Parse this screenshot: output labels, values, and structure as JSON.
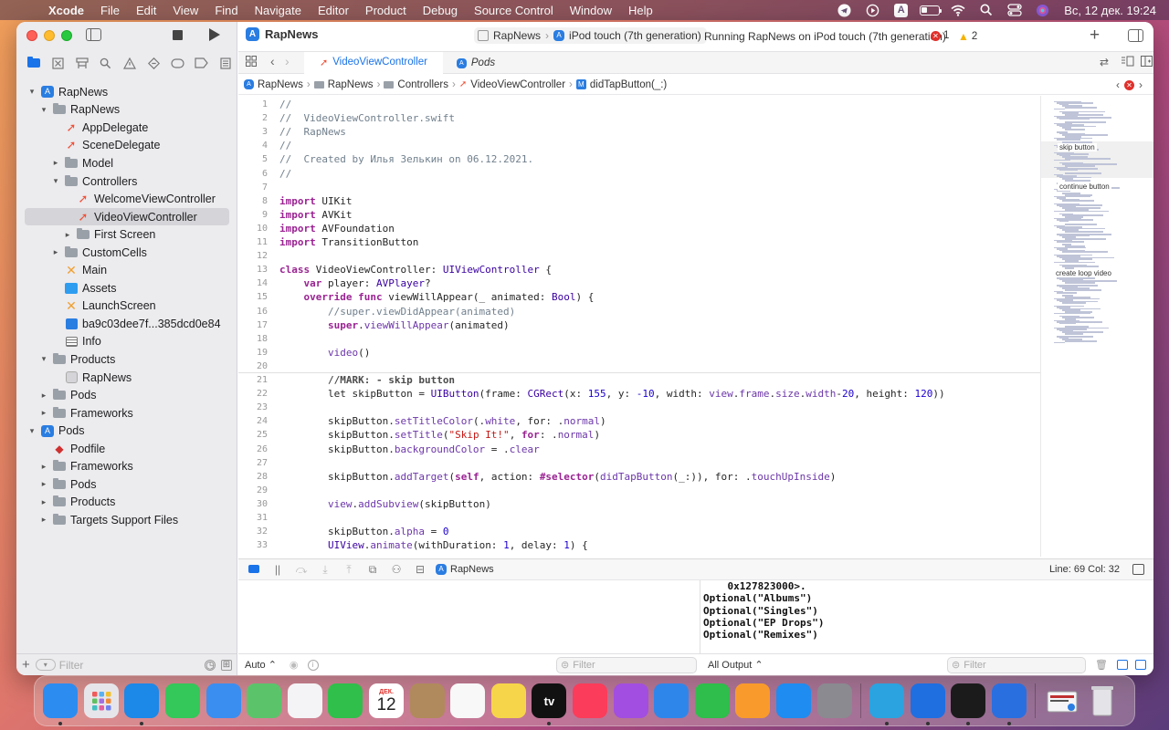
{
  "menubar": {
    "app_name": "Xcode",
    "items": [
      "File",
      "Edit",
      "View",
      "Find",
      "Navigate",
      "Editor",
      "Product",
      "Debug",
      "Source Control",
      "Window",
      "Help"
    ],
    "status_icons": [
      "telegram-icon",
      "play-circle-icon",
      "keyboard-A-icon",
      "battery-icon",
      "wifi-icon",
      "search-icon",
      "control-center-icon",
      "siri-icon"
    ],
    "keyboard_letter": "A",
    "clock": "Вс, 12 дек.  19:24"
  },
  "toolbar": {
    "project_title": "RapNews",
    "scheme": "RapNews",
    "device": "iPod touch (7th generation)",
    "status": "Running RapNews on iPod touch (7th generation)",
    "error_count": "1",
    "warning_count": "2"
  },
  "tabs": [
    {
      "label": "VideoViewController",
      "active": true
    },
    {
      "label": "Pods",
      "active": false
    }
  ],
  "breadcrumb": [
    "RapNews",
    "RapNews",
    "Controllers",
    "VideoViewController",
    "didTapButton(_:)"
  ],
  "breadcrumb_method_badge": "M",
  "navigator": {
    "filter_placeholder": "Filter",
    "tree": [
      {
        "label": "RapNews",
        "icon": "project",
        "depth": 0,
        "disclosure": "open"
      },
      {
        "label": "RapNews",
        "icon": "folder",
        "depth": 1,
        "disclosure": "open"
      },
      {
        "label": "AppDelegate",
        "icon": "swift",
        "depth": 2,
        "disclosure": ""
      },
      {
        "label": "SceneDelegate",
        "icon": "swift",
        "depth": 2,
        "disclosure": ""
      },
      {
        "label": "Model",
        "icon": "folder",
        "depth": 2,
        "disclosure": "closed"
      },
      {
        "label": "Controllers",
        "icon": "folder",
        "depth": 2,
        "disclosure": "open"
      },
      {
        "label": "WelcomeViewController",
        "icon": "swift",
        "depth": 3,
        "disclosure": ""
      },
      {
        "label": "VideoViewController",
        "icon": "swift",
        "depth": 3,
        "disclosure": "",
        "selected": true
      },
      {
        "label": "First Screen",
        "icon": "folder",
        "depth": 3,
        "disclosure": "closed"
      },
      {
        "label": "CustomCells",
        "icon": "folder",
        "depth": 2,
        "disclosure": "closed"
      },
      {
        "label": "Main",
        "icon": "xib",
        "depth": 2,
        "disclosure": ""
      },
      {
        "label": "Assets",
        "icon": "assets",
        "depth": 2,
        "disclosure": ""
      },
      {
        "label": "LaunchScreen",
        "icon": "xib",
        "depth": 2,
        "disclosure": ""
      },
      {
        "label": "ba9c03dee7f...385dcd0e84",
        "icon": "hash",
        "depth": 2,
        "disclosure": ""
      },
      {
        "label": "Info",
        "icon": "plist",
        "depth": 2,
        "disclosure": ""
      },
      {
        "label": "Products",
        "icon": "folder",
        "depth": 1,
        "disclosure": "open"
      },
      {
        "label": "RapNews",
        "icon": "app",
        "depth": 2,
        "disclosure": ""
      },
      {
        "label": "Pods",
        "icon": "folder",
        "depth": 1,
        "disclosure": "closed"
      },
      {
        "label": "Frameworks",
        "icon": "folder",
        "depth": 1,
        "disclosure": "closed"
      },
      {
        "label": "Pods",
        "icon": "project",
        "depth": 0,
        "disclosure": "open"
      },
      {
        "label": "Podfile",
        "icon": "ruby",
        "depth": 1,
        "disclosure": ""
      },
      {
        "label": "Frameworks",
        "icon": "folder",
        "depth": 1,
        "disclosure": "closed"
      },
      {
        "label": "Pods",
        "icon": "folder",
        "depth": 1,
        "disclosure": "closed"
      },
      {
        "label": "Products",
        "icon": "folder",
        "depth": 1,
        "disclosure": "closed"
      },
      {
        "label": "Targets Support Files",
        "icon": "folder",
        "depth": 1,
        "disclosure": "closed"
      }
    ]
  },
  "code_lines": [
    [
      [
        "//",
        "cm"
      ]
    ],
    [
      [
        "//  VideoViewController.swift",
        "cm"
      ]
    ],
    [
      [
        "//  RapNews",
        "cm"
      ]
    ],
    [
      [
        "//",
        "cm"
      ]
    ],
    [
      [
        "//  Created by Илья Зелькин on 06.12.2021.",
        "cm"
      ]
    ],
    [
      [
        "//",
        "cm"
      ]
    ],
    [],
    [
      [
        "import",
        "kw"
      ],
      [
        " UIKit",
        ""
      ]
    ],
    [
      [
        "import",
        "kw"
      ],
      [
        " AVKit",
        ""
      ]
    ],
    [
      [
        "import",
        "kw"
      ],
      [
        " AVFoundation",
        ""
      ]
    ],
    [
      [
        "import",
        "kw"
      ],
      [
        " TransitionButton",
        ""
      ]
    ],
    [],
    [
      [
        "class",
        "kw"
      ],
      [
        " VideoViewController: ",
        ""
      ],
      [
        "UIViewController",
        "ty"
      ],
      [
        " {",
        ""
      ]
    ],
    [
      [
        "    ",
        ""
      ],
      [
        "var",
        "kw"
      ],
      [
        " player: ",
        ""
      ],
      [
        "AVPlayer",
        "ty"
      ],
      [
        "?",
        ""
      ]
    ],
    [
      [
        "    ",
        ""
      ],
      [
        "override func",
        "kw"
      ],
      [
        " viewWillAppear(_ animated: ",
        ""
      ],
      [
        "Bool",
        "ty"
      ],
      [
        ") {",
        ""
      ]
    ],
    [
      [
        "        //super.viewDidAppear(animated)",
        "cm"
      ]
    ],
    [
      [
        "        ",
        ""
      ],
      [
        "super",
        "kw"
      ],
      [
        ".",
        ""
      ],
      [
        "viewWillAppear",
        "fn"
      ],
      [
        "(animated)",
        ""
      ]
    ],
    [],
    [
      [
        "        ",
        ""
      ],
      [
        "video",
        "fn"
      ],
      [
        "()",
        ""
      ]
    ],
    [],
    [
      [
        "        ",
        ""
      ],
      [
        "//MARK: - skip button",
        "mk"
      ]
    ],
    [
      [
        "        let skipButton = ",
        ""
      ],
      [
        "UIButton",
        "ty"
      ],
      [
        "(frame: ",
        ""
      ],
      [
        "CGRect",
        "ty"
      ],
      [
        "(x: ",
        ""
      ],
      [
        "155",
        "num"
      ],
      [
        ", y: ",
        ""
      ],
      [
        "-10",
        "num"
      ],
      [
        ", width: ",
        ""
      ],
      [
        "view",
        "fn"
      ],
      [
        ".",
        ""
      ],
      [
        "frame",
        "fn"
      ],
      [
        ".",
        ""
      ],
      [
        "size",
        "fn"
      ],
      [
        ".",
        ""
      ],
      [
        "width",
        "fn"
      ],
      [
        "-",
        ""
      ],
      [
        "20",
        "num"
      ],
      [
        ", height: ",
        ""
      ],
      [
        "120",
        "num"
      ],
      [
        "))",
        ""
      ]
    ],
    [],
    [
      [
        "        skipButton.",
        ""
      ],
      [
        "setTitleColor",
        "fn"
      ],
      [
        "(.",
        ""
      ],
      [
        "white",
        "fn"
      ],
      [
        ", for: .",
        ""
      ],
      [
        "normal",
        "fn"
      ],
      [
        ")",
        ""
      ]
    ],
    [
      [
        "        skipButton.",
        ""
      ],
      [
        "setTitle",
        "fn"
      ],
      [
        "(",
        ""
      ],
      [
        "\"Skip It!\"",
        "str"
      ],
      [
        ", ",
        ""
      ],
      [
        "for",
        "kw"
      ],
      [
        ": .",
        ""
      ],
      [
        "normal",
        "fn"
      ],
      [
        ")",
        ""
      ]
    ],
    [
      [
        "        skipButton.",
        ""
      ],
      [
        "backgroundColor",
        "fn"
      ],
      [
        " = .",
        ""
      ],
      [
        "clear",
        "fn"
      ]
    ],
    [],
    [
      [
        "        skipButton.",
        ""
      ],
      [
        "addTarget",
        "fn"
      ],
      [
        "(",
        ""
      ],
      [
        "self",
        "kw"
      ],
      [
        ", action: ",
        ""
      ],
      [
        "#selector",
        "kw"
      ],
      [
        "(",
        ""
      ],
      [
        "didTapButton",
        "fn"
      ],
      [
        "(_:)), for: .",
        ""
      ],
      [
        "touchUpInside",
        "fn"
      ],
      [
        ")",
        ""
      ]
    ],
    [],
    [
      [
        "        ",
        ""
      ],
      [
        "view",
        "fn"
      ],
      [
        ".",
        ""
      ],
      [
        "addSubview",
        "fn"
      ],
      [
        "(skipButton)",
        ""
      ]
    ],
    [],
    [
      [
        "        skipButton.",
        ""
      ],
      [
        "alpha",
        "fn"
      ],
      [
        " = ",
        ""
      ],
      [
        "0",
        "num"
      ]
    ],
    [
      [
        "        ",
        ""
      ],
      [
        "UIView",
        "ty"
      ],
      [
        ".",
        ""
      ],
      [
        "animate",
        "fn"
      ],
      [
        "(withDuration: ",
        ""
      ],
      [
        "1",
        "num"
      ],
      [
        ", delay: ",
        ""
      ],
      [
        "1",
        "num"
      ],
      [
        ") {",
        ""
      ]
    ]
  ],
  "minimap_labels": [
    "skip button",
    "continue button",
    "create loop video"
  ],
  "debug": {
    "target": "RapNews",
    "line_col": "Line: 69  Col: 32",
    "auto_label": "Auto",
    "all_output_label": "All Output",
    "filter_placeholder": "Filter",
    "console_lines": [
      "    0x127823000>.",
      "Optional(\"Albums\")",
      "Optional(\"Singles\")",
      "Optional(\"EP Drops\")",
      "Optional(\"Remixes\")"
    ]
  },
  "dock": {
    "apps": [
      {
        "name": "finder",
        "color": "#2c8cf0",
        "running": true
      },
      {
        "name": "launchpad",
        "color": "#e6e6ea",
        "running": false
      },
      {
        "name": "safari",
        "color": "#1c88e8",
        "running": true
      },
      {
        "name": "messages",
        "color": "#34c759",
        "running": false
      },
      {
        "name": "mail",
        "color": "#3a8ef0",
        "running": false
      },
      {
        "name": "maps",
        "color": "#5bc46b",
        "running": false
      },
      {
        "name": "photos",
        "color": "#f4f4f6",
        "running": false
      },
      {
        "name": "facetime",
        "color": "#2fbf4a",
        "running": false
      },
      {
        "name": "calendar",
        "color": "#ffffff",
        "running": false
      },
      {
        "name": "contacts",
        "color": "#b08a5c",
        "running": false
      },
      {
        "name": "reminders",
        "color": "#f8f8f8",
        "running": false
      },
      {
        "name": "notes",
        "color": "#f7d54a",
        "running": false
      },
      {
        "name": "tv",
        "color": "#111111",
        "running": true
      },
      {
        "name": "music",
        "color": "#fb3c5a",
        "running": false
      },
      {
        "name": "podcasts",
        "color": "#a24ee0",
        "running": false
      },
      {
        "name": "keynote",
        "color": "#2f86ea",
        "running": false
      },
      {
        "name": "numbers",
        "color": "#2fbd4b",
        "running": false
      },
      {
        "name": "pages",
        "color": "#f99b2c",
        "running": false
      },
      {
        "name": "app-store",
        "color": "#1e8cf0",
        "running": false
      },
      {
        "name": "system-preferences",
        "color": "#8a8a90",
        "running": false
      }
    ],
    "right_apps": [
      {
        "name": "telegram",
        "color": "#2aa3e0",
        "running": true
      },
      {
        "name": "xcode",
        "color": "#1f6fe0",
        "running": true
      },
      {
        "name": "terminal",
        "color": "#1b1b1b",
        "running": true
      },
      {
        "name": "instruments",
        "color": "#2a6fe0",
        "running": true
      }
    ],
    "trailing": [
      {
        "name": "preview-documents",
        "color": "#e8e8ec"
      },
      {
        "name": "trash",
        "color": "#dcdce0"
      }
    ],
    "calendar_month": "ДЕК.",
    "calendar_day": "12",
    "tv_label": "tv"
  }
}
